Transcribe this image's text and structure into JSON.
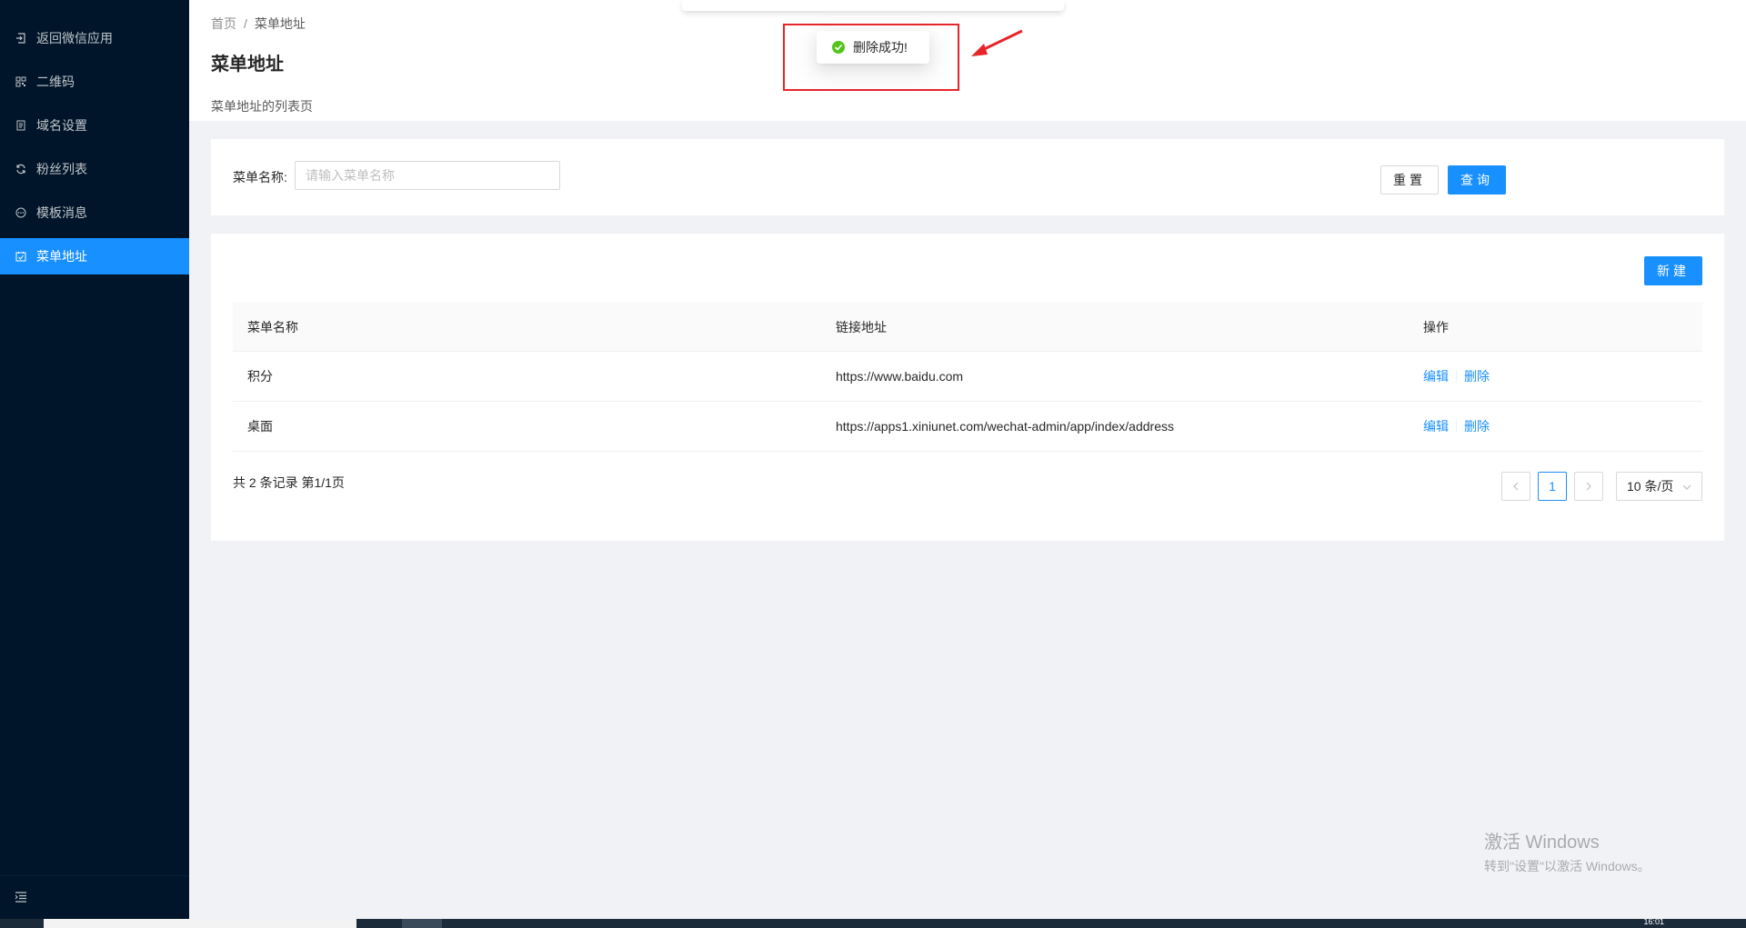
{
  "sidebar": {
    "items": [
      {
        "label": "返回微信应用",
        "icon": "logout-icon"
      },
      {
        "label": "二维码",
        "icon": "qrcode-icon"
      },
      {
        "label": "域名设置",
        "icon": "document-icon"
      },
      {
        "label": "粉丝列表",
        "icon": "sync-icon"
      },
      {
        "label": "模板消息",
        "icon": "message-icon"
      },
      {
        "label": "菜单地址",
        "icon": "schedule-icon",
        "active": true
      }
    ],
    "collapse_icon": "menu-fold-icon"
  },
  "header": {
    "breadcrumb": [
      "首页",
      "菜单地址"
    ],
    "breadcrumb_separator": "/",
    "title": "菜单地址",
    "description": "菜单地址的列表页"
  },
  "search": {
    "label": "菜单名称:",
    "placeholder": "请输入菜单名称",
    "value": "",
    "reset_label": "重置",
    "query_label": "查询"
  },
  "table": {
    "new_label": "新建",
    "columns": [
      "菜单名称",
      "链接地址",
      "操作"
    ],
    "rows": [
      {
        "name": "积分",
        "url": "https://www.baidu.com",
        "edit": "编辑",
        "delete": "删除"
      },
      {
        "name": "桌面",
        "url": "https://apps1.xiniunet.com/wechat-admin/app/index/address",
        "edit": "编辑",
        "delete": "删除"
      }
    ],
    "total_text": "共 2 条记录 第1/1页",
    "current_page": "1",
    "page_size": "10 条/页"
  },
  "toast": {
    "message": "删除成功!",
    "icon": "check-circle-icon",
    "color": "#52c41a"
  },
  "watermark": {
    "title": "激活 Windows",
    "subtitle": "转到\"设置\"以激活 Windows。"
  },
  "taskbar": {
    "time": "16:01"
  },
  "colors": {
    "primary": "#1890ff",
    "sidebar_bg": "#001529",
    "annotation": "#e5262b"
  }
}
